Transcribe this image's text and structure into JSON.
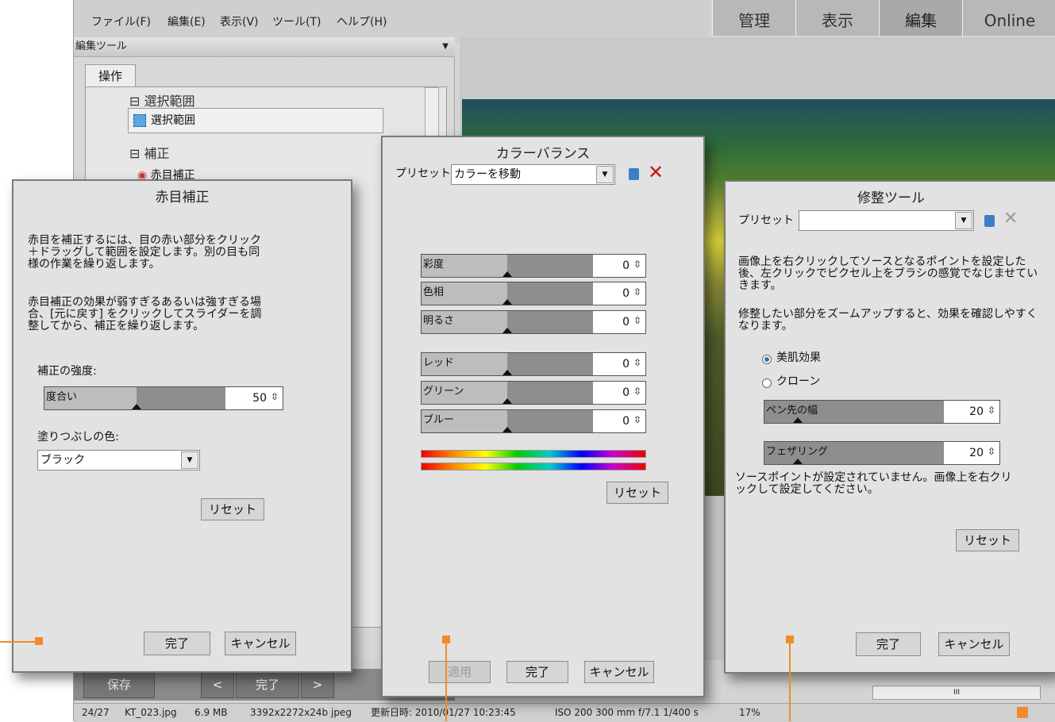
{
  "menu": [
    "ファイル(F)",
    "編集(E)",
    "表示(V)",
    "ツール(T)",
    "ヘルプ(H)"
  ],
  "top_tabs": [
    "管理",
    "表示",
    "編集",
    "Online"
  ],
  "left_panel": {
    "header": "編集ツール",
    "tab": "操作",
    "section_selection": "選択範囲",
    "tool_selection": "選択範囲",
    "section_correction": "補正",
    "tool_redeye": "赤目補正"
  },
  "bottom_bar": {
    "save": "保存",
    "prev": "<",
    "done": "完了",
    "next": ">"
  },
  "status": {
    "index": "24/27",
    "file": "KT_023.jpg",
    "size": "6.9 MB",
    "dims": "3392x2272x24b jpeg",
    "modified": "更新日時: 2010/01/27 10:23:45",
    "exif": "ISO 200   300 mm   f/7.1   1/400 s",
    "zoom": "17%",
    "scroll_grip": "III"
  },
  "redeye": {
    "title": "赤目補正",
    "text1": "赤目を補正するには、目の赤い部分をクリック＋ドラッグして範囲を設定します。別の目も同様の作業を繰り返します。",
    "text2": "赤目補正の効果が弱すぎるあるいは強すぎる場合、[元に戻す] をクリックしてスライダーを調整してから、補正を繰り返します。",
    "strength_label": "補正の強度:",
    "slider_label": "度合い",
    "slider_value": "50",
    "fill_label": "塗りつぶしの色:",
    "fill_value": "ブラック",
    "reset": "リセット",
    "done": "完了",
    "cancel": "キャンセル"
  },
  "colorbalance": {
    "title": "カラーバランス",
    "preset_label": "プリセット",
    "preset_value": "カラーを移動",
    "sliders": [
      {
        "label": "彩度",
        "value": "0"
      },
      {
        "label": "色相",
        "value": "0"
      },
      {
        "label": "明るさ",
        "value": "0"
      },
      {
        "label": "レッド",
        "value": "0"
      },
      {
        "label": "グリーン",
        "value": "0"
      },
      {
        "label": "ブルー",
        "value": "0"
      }
    ],
    "reset": "リセット",
    "apply": "適用",
    "done": "完了",
    "cancel": "キャンセル"
  },
  "retouch": {
    "title": "修整ツール",
    "preset_label": "プリセット",
    "preset_value": "",
    "text1": "画像上を右クリックしてソースとなるポイントを設定した後、左クリックでピクセル上をブラシの感覚でなじませていきます。",
    "text2": "修整したい部分をズームアップすると、効果を確認しやすくなります。",
    "radio1": "美肌効果",
    "radio2": "クローン",
    "pen_label": "ペン先の幅",
    "pen_value": "20",
    "feather_label": "フェザリング",
    "feather_value": "20",
    "note": "ソースポイントが設定されていません。画像上を右クリックして設定してください。",
    "reset": "リセット",
    "done": "完了",
    "cancel": "キャンセル"
  },
  "colors": {
    "accent": "#f08a2c",
    "delete": "#cc1111",
    "save": "#3a7fc7"
  }
}
